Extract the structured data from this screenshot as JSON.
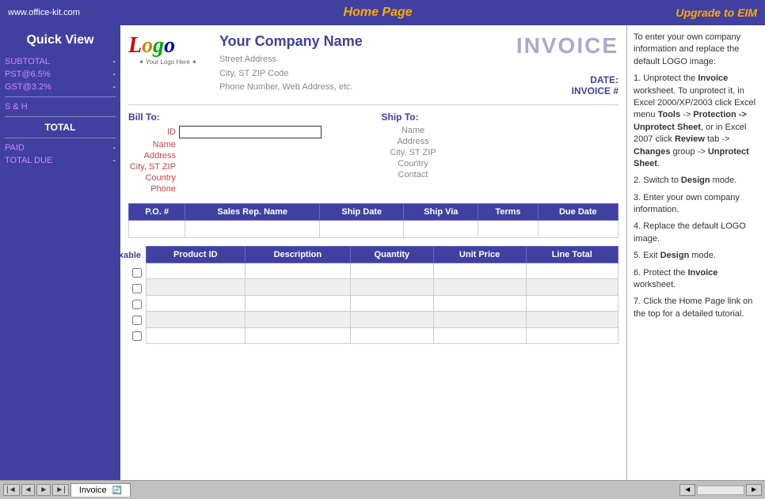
{
  "topbar": {
    "site_url": "www.office-kit.com",
    "home_page_label": "Home Page",
    "upgrade_label": "Upgrade to EIM"
  },
  "sidebar": {
    "quick_view_label": "Quick  View",
    "items": [
      {
        "label": "SUBTOTAL",
        "value": "-"
      },
      {
        "label": "PST@6.5%",
        "value": "-"
      },
      {
        "label": "GST@3.2%",
        "value": "-"
      },
      {
        "label": "S & H",
        "value": ""
      },
      {
        "label": "TOTAL",
        "value": ""
      },
      {
        "label": "PAID",
        "value": "-"
      },
      {
        "label": "TOTAL DUE",
        "value": "-"
      }
    ]
  },
  "invoice": {
    "logo_text": "Logo",
    "logo_sub": "Your Logo Here",
    "company_name": "Your Company Name",
    "company_address": "Street Address",
    "company_city": "City, ST  ZIP Code",
    "company_phone": "Phone Number, Web Address, etc.",
    "invoice_title": "INVOICE",
    "date_label": "DATE:",
    "invoice_num_label": "INVOICE #",
    "bill_to_label": "Bill To:",
    "bill_id_label": "ID",
    "bill_name_label": "Name",
    "bill_address_label": "Address",
    "bill_city_label": "City, ST ZIP",
    "bill_country_label": "Country",
    "bill_phone_label": "Phone",
    "ship_to_label": "Ship To:",
    "ship_name_label": "Name",
    "ship_address_label": "Address",
    "ship_city_label": "City, ST ZIP",
    "ship_country_label": "Country",
    "ship_contact_label": "Contact",
    "po_columns": [
      "P.O. #",
      "Sales Rep. Name",
      "Ship Date",
      "Ship Via",
      "Terms",
      "Due Date"
    ],
    "taxable_label": "Taxable",
    "product_columns": [
      "Product ID",
      "Description",
      "Quantity",
      "Unit Price",
      "Line Total"
    ],
    "product_rows": [
      [
        "",
        "",
        "",
        "",
        ""
      ],
      [
        "",
        "",
        "",
        "",
        ""
      ],
      [
        "",
        "",
        "",
        "",
        ""
      ],
      [
        "",
        "",
        "",
        "",
        ""
      ],
      [
        "",
        "",
        "",
        "",
        ""
      ]
    ]
  },
  "help": {
    "intro": "To enter your own company information and replace the default LOGO image:",
    "steps": [
      "1. Unprotect the Invoice worksheet. To unprotect it, in Excel 2000/XP/2003 click Excel menu Tools -> Protection -> Unprotect Sheet, or in Excel 2007 click Review tab -> Changes group -> Unprotect Sheet.",
      "2. Switch to Design mode.",
      "3. Enter your own company information.",
      "4. Replace the default LOGO image.",
      "5. Exit Design mode.",
      "6. Protect the Invoice worksheet.",
      "7. Click the Home Page link on the top for a detailed tutorial."
    ]
  },
  "tabs": {
    "sheet_label": "Invoice",
    "tab_icon": "🔄"
  }
}
